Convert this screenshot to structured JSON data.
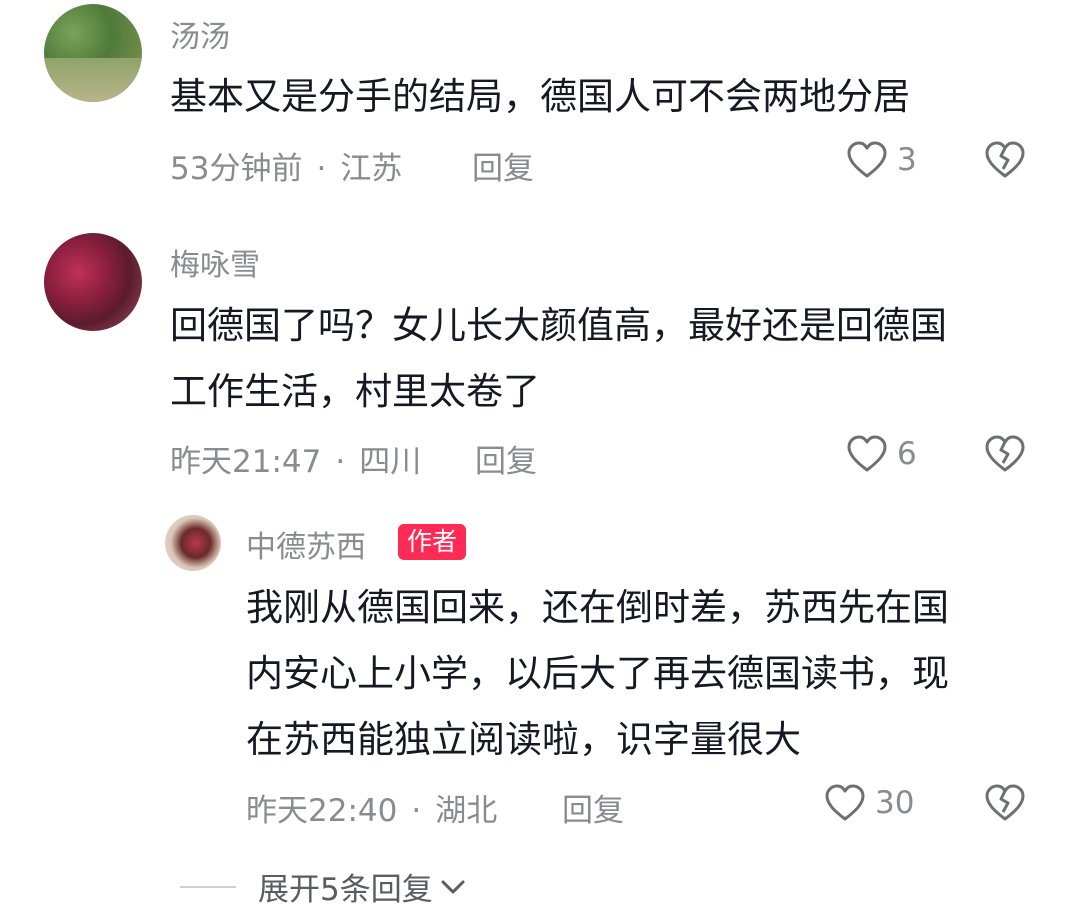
{
  "comments": [
    {
      "username": "汤汤",
      "text_lines": [
        "基本又是分手的结局，德国人可不会两地分居"
      ],
      "time": "53分钟前",
      "location": "江苏",
      "reply_label": "回复",
      "like_count": "3"
    },
    {
      "username": "梅咏雪",
      "text_lines": [
        "回德国了吗？女儿长大颜值高，最好还是回德国",
        "工作生活，村里太卷了"
      ],
      "time": "昨天21:47",
      "location": "四川",
      "reply_label": "回复",
      "like_count": "6"
    }
  ],
  "reply": {
    "username": "中德苏西",
    "badge": "作者",
    "text_lines": [
      "我刚从德国回来，还在倒时差，苏西先在国",
      "内安心上小学，以后大了再去德国读书，现",
      "在苏西能独立阅读啦，识字量很大"
    ],
    "time": "昨天22:40",
    "location": "湖北",
    "reply_label": "回复",
    "like_count": "30"
  },
  "meta_separator": "·",
  "expand_label": "展开5条回复",
  "colors": {
    "badge": "#fe2c55",
    "meta": "#8a8b91",
    "text": "#161823"
  }
}
